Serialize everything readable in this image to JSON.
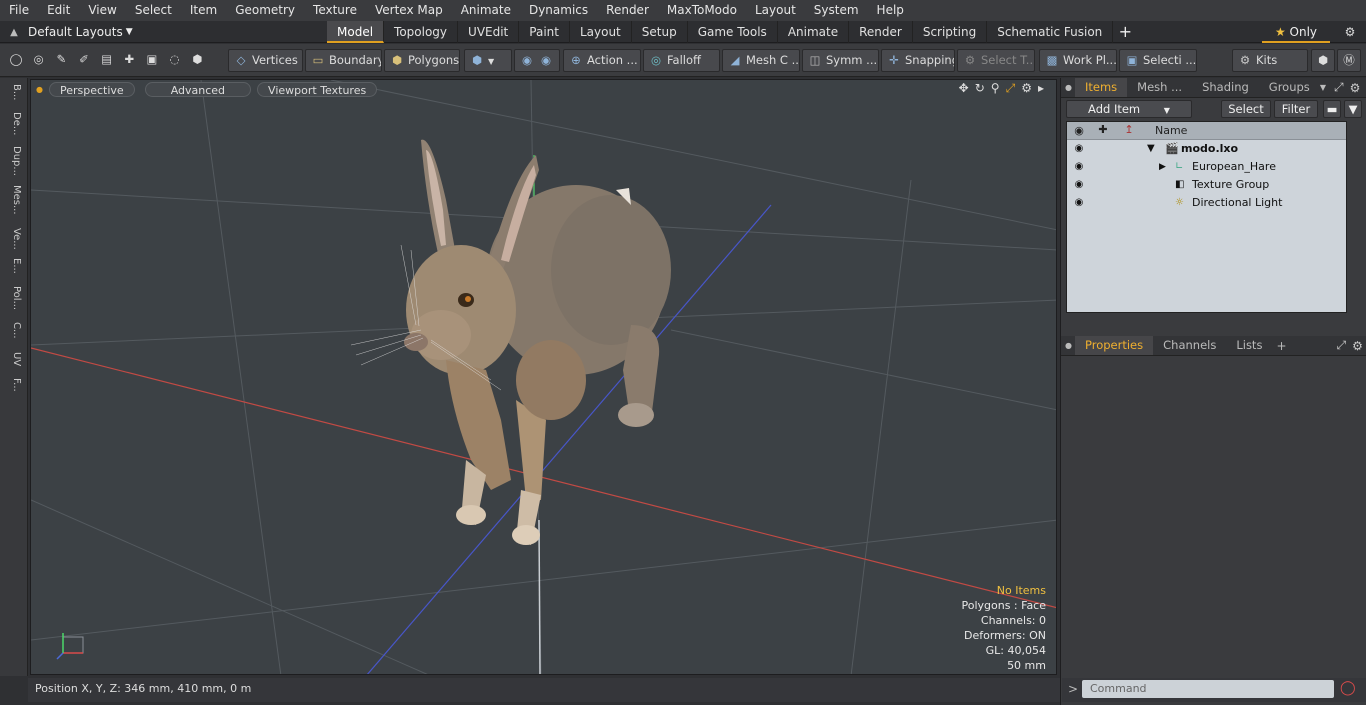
{
  "menu": [
    "File",
    "Edit",
    "View",
    "Select",
    "Item",
    "Geometry",
    "Texture",
    "Vertex Map",
    "Animate",
    "Dynamics",
    "Render",
    "MaxToModo",
    "Layout",
    "System",
    "Help"
  ],
  "layout_selector": "Default Layouts",
  "tabs": [
    "Model",
    "Topology",
    "UVEdit",
    "Paint",
    "Layout",
    "Setup",
    "Game Tools",
    "Animate",
    "Render",
    "Scripting",
    "Schematic Fusion"
  ],
  "active_tab": "Model",
  "only_label": "Only",
  "toolbar": {
    "vertices": "Vertices",
    "boundary": "Boundary",
    "polygons": "Polygons",
    "action": "Action",
    "falloff": "Falloff",
    "mesh": "Mesh C ...",
    "symmetry": "Symm ...",
    "snapping": "Snapping",
    "select_t": "Select T...",
    "workplane": "Work Pl...",
    "selection": "Selecti ...",
    "kits": "Kits"
  },
  "left_tabs": [
    "B...",
    "De...",
    "Dup...",
    "Mes...",
    "Ve...",
    "E...",
    "Pol...",
    "C...",
    "UV",
    "F..."
  ],
  "viewport": {
    "view_mode": "Perspective",
    "shading": "Advanced",
    "textures": "Viewport Textures",
    "info": {
      "status": "No Items",
      "polygons": "Polygons : Face",
      "channels": "Channels: 0",
      "deformers": "Deformers: ON",
      "gl": "GL: 40,054",
      "focal": "50 mm"
    },
    "axis_colors": {
      "x": "#d94b4b",
      "y": "#4bd96a",
      "z": "#4b6ad9"
    }
  },
  "statusbar": {
    "position": "Position X, Y, Z:  346 mm, 410 mm, 0 m"
  },
  "items_panel": {
    "tabs": [
      "Items",
      "Mesh ...",
      "Shading",
      "Groups"
    ],
    "active_tab": "Items",
    "add_item": "Add Item",
    "select": "Select",
    "filter": "Filter",
    "column_name": "Name",
    "tree": [
      {
        "label": "modo.lxo"
      },
      {
        "label": "European_Hare"
      },
      {
        "label": "Texture Group"
      },
      {
        "label": "Directional Light"
      }
    ]
  },
  "properties_panel": {
    "tabs": [
      "Properties",
      "Channels",
      "Lists"
    ],
    "active_tab": "Properties"
  },
  "command": {
    "placeholder": "Command"
  }
}
